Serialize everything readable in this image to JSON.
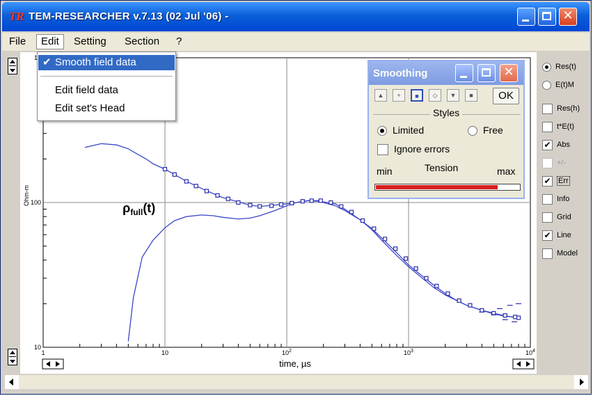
{
  "window": {
    "app_icon": "TR",
    "title": "TEM-RESEARCHER v.7.13 (02 Jul '06) -"
  },
  "menubar": {
    "items": [
      "File",
      "Edit",
      "Setting",
      "Section",
      "?"
    ]
  },
  "edit_menu": {
    "items": [
      {
        "label": "Smooth field data",
        "checked": true,
        "highlighted": true
      },
      {
        "label": "Edit field data",
        "checked": false
      },
      {
        "label": "Edit set's Head",
        "checked": false
      }
    ],
    "check_mark": "✔"
  },
  "smoothing_dialog": {
    "title": "Smoothing",
    "ok_label": "OK",
    "symbol_icons": [
      "triangle-symbol-icon",
      "plus-symbol-icon",
      "square-symbol-icon",
      "circle-symbol-icon",
      "down-triangle-symbol-icon",
      "dot-symbol-icon"
    ],
    "symbol_glyphs": [
      "▲",
      "+",
      "■",
      "◇",
      "▼",
      "■"
    ],
    "selected_symbol": 2,
    "styles_label": "Styles",
    "limited_label": "Limited",
    "free_label": "Free",
    "ignore_errors_label": "Ignore errors",
    "tension_label": "Tension",
    "min_label": "min",
    "max_label": "max",
    "tension_value": 0.85,
    "accent_color": "#d81e1e"
  },
  "right_panel": {
    "radios": [
      {
        "label": "Res(t)",
        "selected": true
      },
      {
        "label": "E(t)M",
        "selected": false
      }
    ],
    "checks": [
      {
        "label": "Res(h)",
        "checked": false,
        "disabled": false
      },
      {
        "label": "t*E(t)",
        "checked": false,
        "disabled": false
      },
      {
        "label": "Abs",
        "checked": true,
        "disabled": false
      },
      {
        "label": "+/-",
        "checked": false,
        "disabled": true
      },
      {
        "label": "Err",
        "checked": true,
        "disabled": false
      },
      {
        "label": "Info",
        "checked": false,
        "disabled": false
      },
      {
        "label": "Grid",
        "checked": false,
        "disabled": false
      },
      {
        "label": "Line",
        "checked": true,
        "disabled": false
      },
      {
        "label": "Model",
        "checked": false,
        "disabled": false
      }
    ]
  },
  "chart_data": {
    "type": "line",
    "x_scale": "log",
    "y_scale": "log",
    "xlim": [
      1,
      10000
    ],
    "ylim": [
      10,
      1000
    ],
    "xlabel": "time, µs",
    "ylabel": "Ohm-m",
    "x_tick_labels": [
      {
        "base": "1",
        "exp": "",
        "value": 1
      },
      {
        "base": "10",
        "exp": "",
        "value": 10
      },
      {
        "base": "10",
        "exp": "2",
        "value": 100
      },
      {
        "base": "10",
        "exp": "3",
        "value": 1000
      },
      {
        "base": "10",
        "exp": "4",
        "value": 10000
      }
    ],
    "y_tick_labels": [
      {
        "base": "10",
        "exp": "",
        "value": 10
      },
      {
        "base": "100",
        "exp": "",
        "value": 100
      },
      {
        "base": "10",
        "exp": "",
        "value": 1000
      }
    ],
    "annotation": {
      "base": "ρ",
      "sub": "full",
      "suffix": "(t)",
      "x": 6.0,
      "y": 82
    },
    "series": [
      {
        "name": "",
        "color": "#3a46c8",
        "values_x": [
          2.2,
          3.0,
          4.0,
          5.0,
          6.0,
          7.0,
          8.0,
          10,
          12,
          15,
          20,
          25,
          30,
          40,
          50,
          60,
          70,
          80,
          100,
          120,
          150,
          180,
          200,
          250,
          300,
          400,
          500,
          600,
          800,
          1000,
          1300,
          1600,
          2000,
          2500,
          3000,
          4000,
          5000,
          6000,
          7000,
          8000
        ],
        "values_y": [
          240,
          255,
          250,
          235,
          215,
          200,
          185,
          170,
          156,
          140,
          125,
          115,
          108,
          101,
          96,
          94,
          95,
          96,
          98,
          100,
          103,
          103,
          101,
          98,
          90,
          76,
          65,
          55,
          43,
          36,
          30,
          26,
          23,
          21,
          19.5,
          18,
          17.2,
          16.6,
          16.2,
          16
        ]
      },
      {
        "name": "",
        "color": "#3a46c8",
        "values_x": [
          5.0,
          5.5,
          6.5,
          8.0,
          10,
          12,
          15,
          20,
          25,
          30,
          40,
          50,
          60,
          80,
          100,
          120,
          150,
          180,
          200,
          250,
          300,
          400,
          500,
          600,
          800,
          1000,
          1300,
          1600,
          2000,
          2500,
          3000,
          4000,
          5000,
          6000,
          8000
        ],
        "values_y": [
          11,
          22,
          42,
          55,
          67,
          75,
          80,
          82,
          81,
          79,
          77,
          78,
          81,
          88,
          95,
          100,
          103,
          102,
          100,
          95,
          88,
          76,
          66,
          57,
          45,
          37,
          31,
          27,
          23.5,
          21,
          19.5,
          18,
          17,
          16.5,
          16
        ]
      }
    ],
    "data_points_x": [
      10,
      12,
      15,
      18,
      22,
      27,
      33,
      40,
      50,
      60,
      75,
      90,
      110,
      135,
      160,
      190,
      230,
      280,
      340,
      420,
      520,
      640,
      780,
      950,
      1150,
      1400,
      1700,
      2100,
      2600,
      3200,
      4000,
      5000,
      6200,
      7500,
      8000
    ],
    "data_points_y": [
      170,
      156,
      140,
      130,
      120,
      112,
      106,
      100,
      96,
      94,
      95,
      97,
      99,
      102,
      103,
      103,
      100,
      94,
      86,
      75,
      66,
      56,
      48,
      41,
      35,
      30,
      26.5,
      23.5,
      21,
      19.5,
      18,
      17.2,
      16.6,
      16.2,
      16
    ],
    "scatter_points_x": [
      4000,
      5000,
      5600,
      6200,
      6800,
      7400,
      8000
    ],
    "scatter_points_y": [
      17.5,
      16.8,
      18.5,
      15.5,
      19.5,
      15,
      20
    ]
  }
}
